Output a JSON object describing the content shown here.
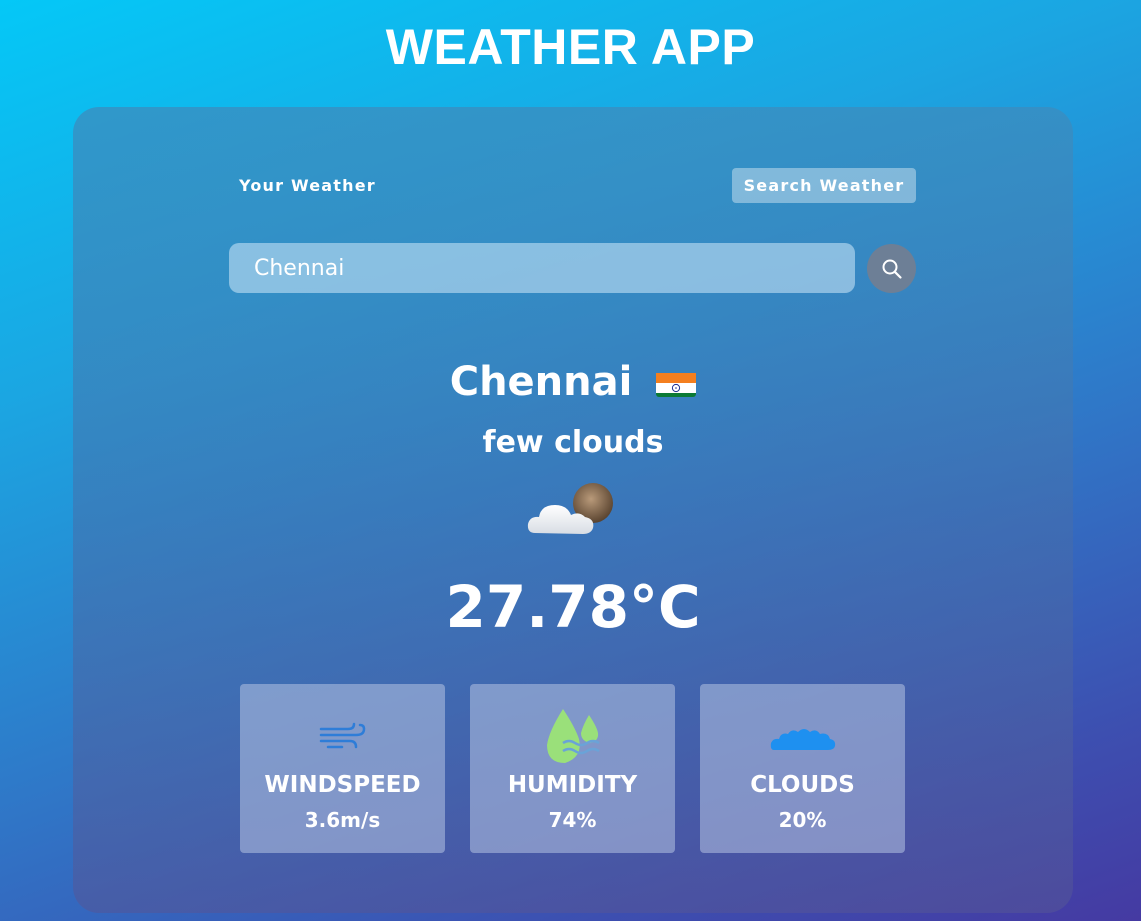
{
  "app": {
    "title": "WEATHER APP"
  },
  "tabs": {
    "your_weather": "Your Weather",
    "search_weather": "Search Weather"
  },
  "search": {
    "value": "Chennai",
    "icon": "search-icon"
  },
  "weather": {
    "city": "Chennai",
    "country_flag": "india-flag-icon",
    "description": "few clouds",
    "icon": "few-clouds-icon",
    "temperature": "27.78°C"
  },
  "stats": {
    "windspeed": {
      "label": "WINDSPEED",
      "value": "3.6m/s",
      "icon": "wind-icon"
    },
    "humidity": {
      "label": "HUMIDITY",
      "value": "74%",
      "icon": "humidity-icon"
    },
    "clouds": {
      "label": "CLOUDS",
      "value": "20%",
      "icon": "clouds-icon"
    }
  },
  "colors": {
    "accent_blue": "#2e7dd8",
    "humidity_green": "#9ae07a",
    "search_button": "#6d7f96"
  }
}
